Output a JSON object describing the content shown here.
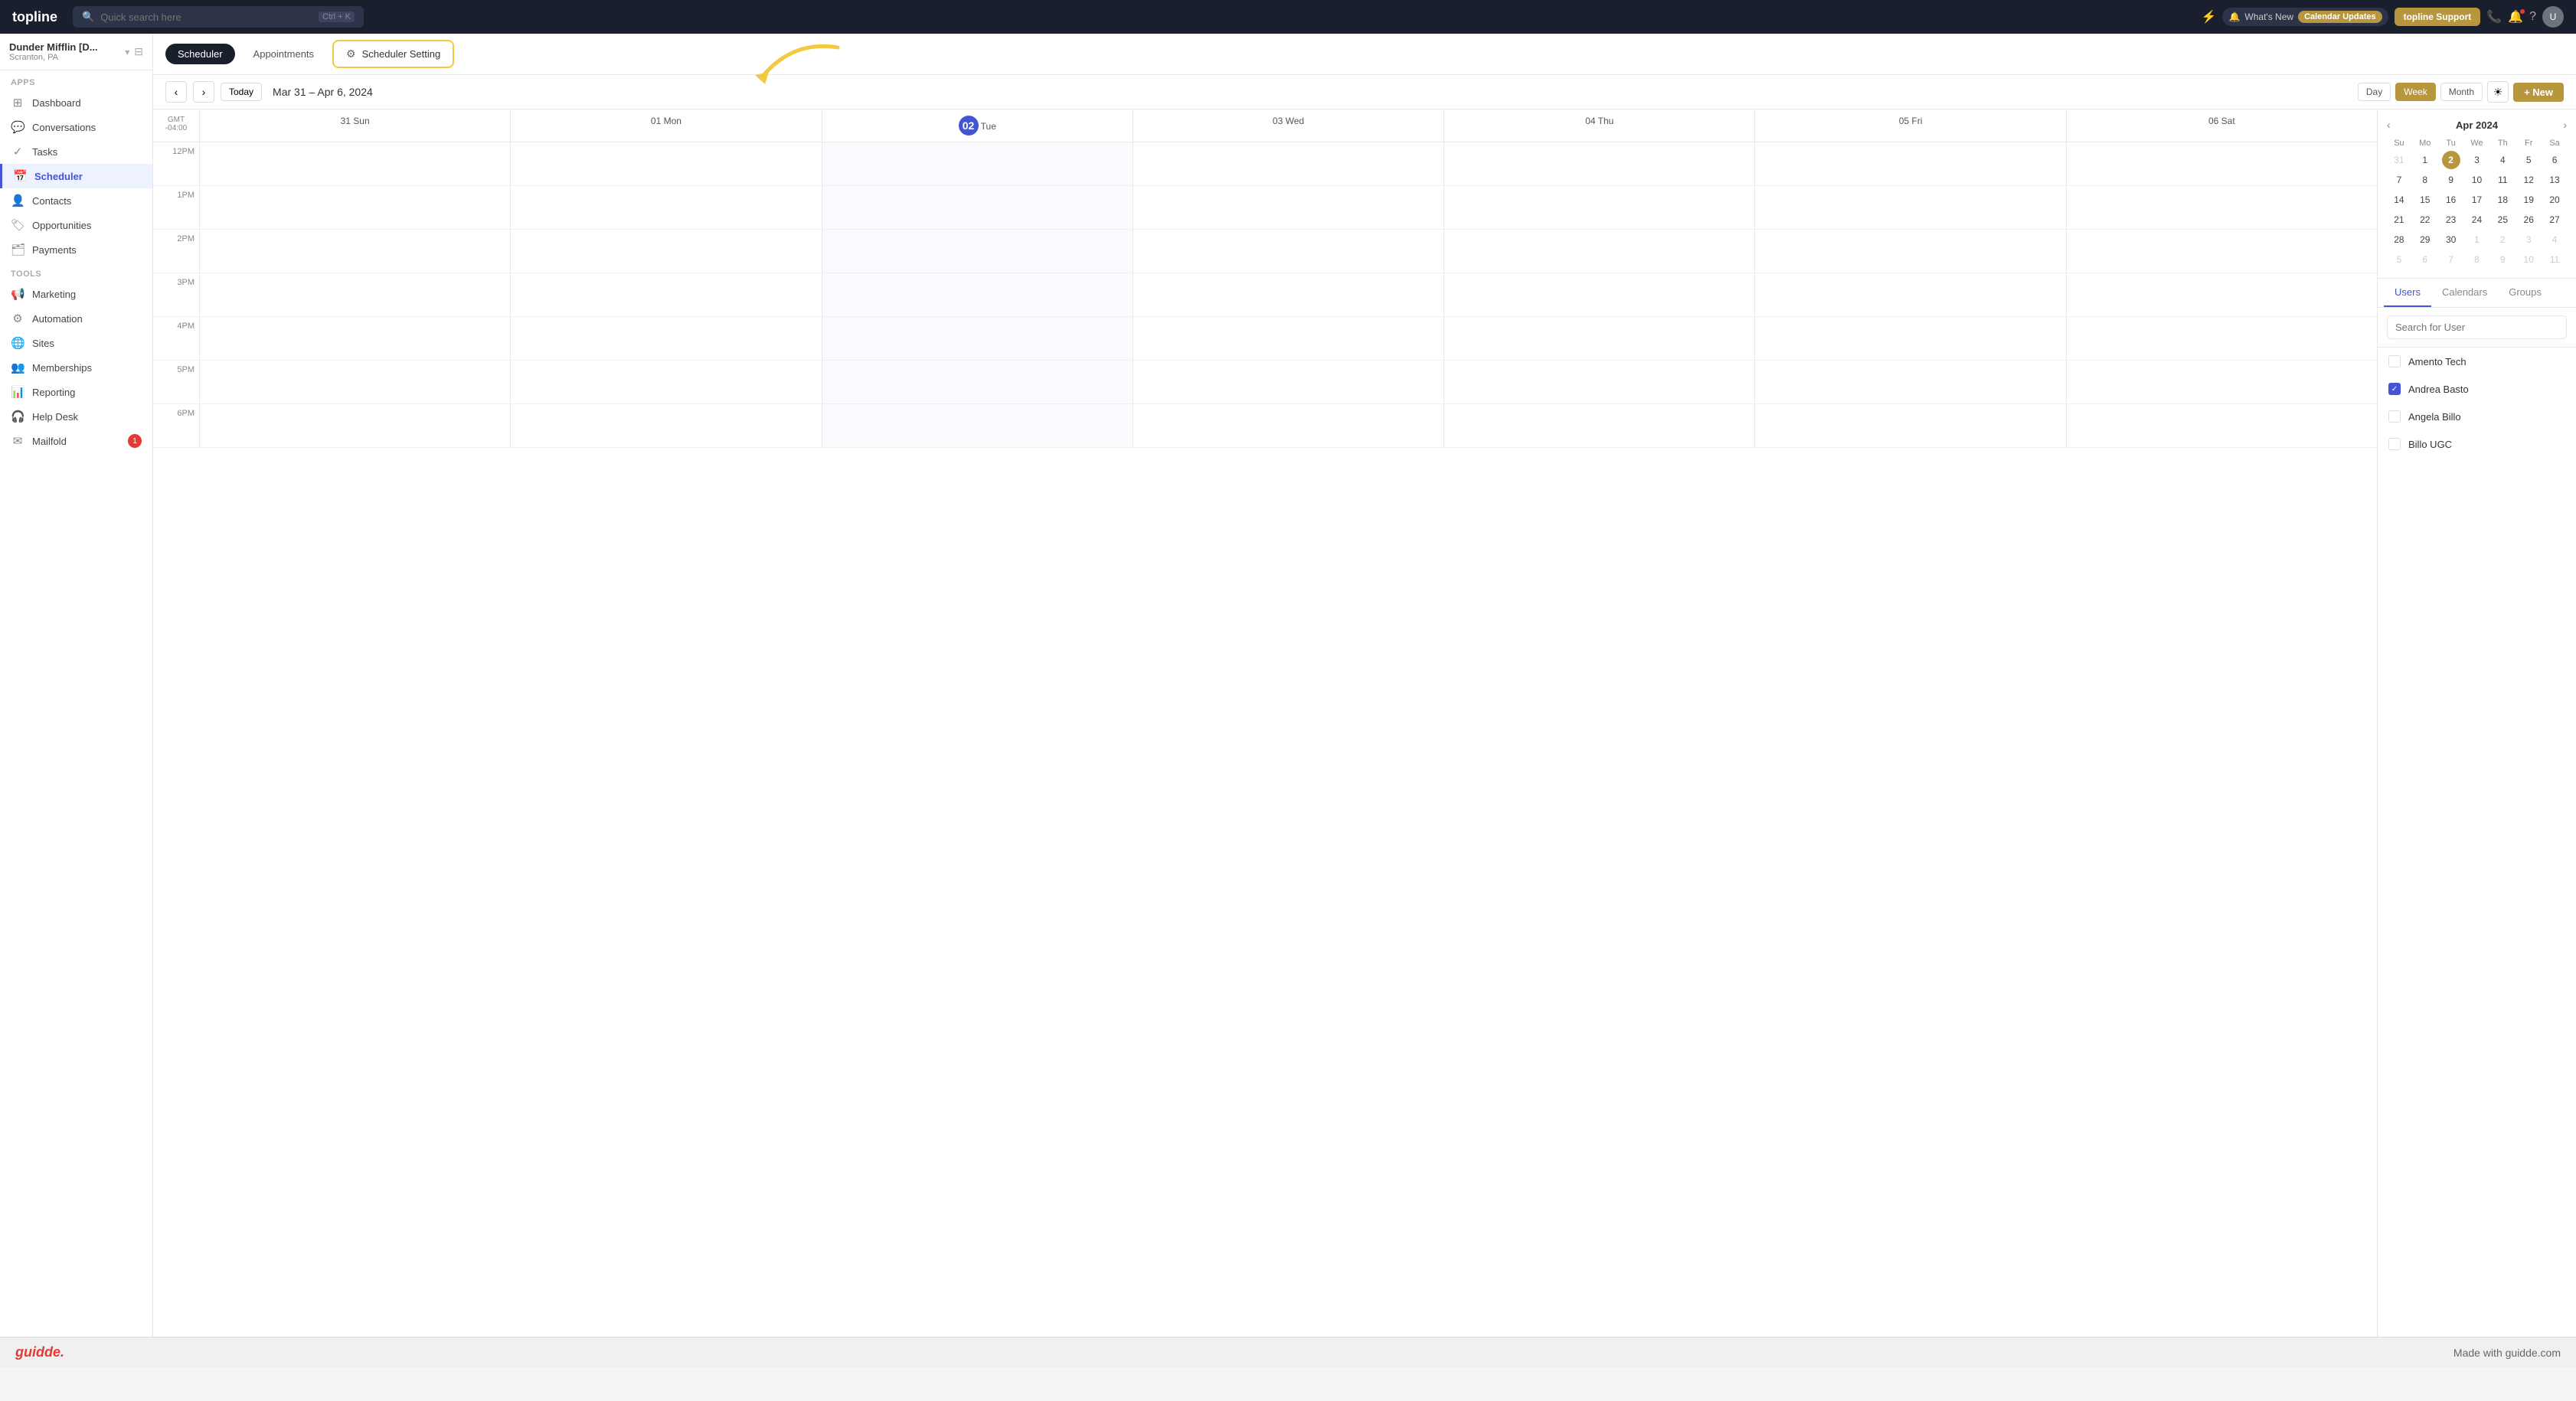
{
  "app": {
    "name": "topline"
  },
  "topbar": {
    "search_placeholder": "Quick search here",
    "shortcut": "Ctrl + K",
    "whats_new": "What's New",
    "calendar_updates": "Calendar Updates",
    "support_btn": "topline Support"
  },
  "sidebar": {
    "workspace_name": "Dunder Mifflin [D...",
    "workspace_location": "Scranton, PA",
    "apps_section": "Apps",
    "tools_section": "Tools",
    "items": [
      {
        "id": "dashboard",
        "label": "Dashboard",
        "icon": "⊞"
      },
      {
        "id": "conversations",
        "label": "Conversations",
        "icon": "💬"
      },
      {
        "id": "tasks",
        "label": "Tasks",
        "icon": "✓"
      },
      {
        "id": "scheduler",
        "label": "Scheduler",
        "icon": "📅",
        "active": true
      },
      {
        "id": "contacts",
        "label": "Contacts",
        "icon": "👤"
      },
      {
        "id": "opportunities",
        "label": "Opportunities",
        "icon": "🏷"
      },
      {
        "id": "payments",
        "label": "Payments",
        "icon": "🗂"
      }
    ],
    "tools": [
      {
        "id": "marketing",
        "label": "Marketing",
        "icon": "📢"
      },
      {
        "id": "automation",
        "label": "Automation",
        "icon": "⚙"
      },
      {
        "id": "sites",
        "label": "Sites",
        "icon": "🌐"
      },
      {
        "id": "memberships",
        "label": "Memberships",
        "icon": "👥"
      },
      {
        "id": "reporting",
        "label": "Reporting",
        "icon": "📊"
      },
      {
        "id": "helpdesk",
        "label": "Help Desk",
        "icon": "🎧"
      },
      {
        "id": "mailfold",
        "label": "Mailfold",
        "icon": "✉",
        "badge": "1"
      }
    ]
  },
  "sub_header": {
    "tabs": [
      {
        "id": "scheduler",
        "label": "Scheduler",
        "active": true
      },
      {
        "id": "appointments",
        "label": "Appointments",
        "active": false
      }
    ],
    "settings_tab": "Scheduler Setting"
  },
  "cal_toolbar": {
    "today_label": "Today",
    "date_range": "Mar 31 – Apr 6, 2024",
    "day_label": "Day",
    "week_label": "Week",
    "month_label": "Month",
    "new_label": "+ New"
  },
  "calendar": {
    "gmt_label": "GMT",
    "gmt_offset": "-04:00",
    "days": [
      {
        "short": "Sun",
        "num": "31",
        "today": false
      },
      {
        "short": "Mon",
        "num": "01",
        "today": false
      },
      {
        "short": "Tue",
        "num": "02",
        "today": true
      },
      {
        "short": "Wed",
        "num": "03",
        "today": false
      },
      {
        "short": "Thu",
        "num": "04",
        "today": false
      },
      {
        "short": "Fri",
        "num": "05",
        "today": false
      },
      {
        "short": "Sat",
        "num": "06",
        "today": false
      }
    ],
    "time_slots": [
      "12PM",
      "1PM",
      "2PM",
      "3PM",
      "4PM",
      "5PM",
      "6PM"
    ]
  },
  "mini_cal": {
    "title": "Apr 2024",
    "day_names": [
      "Su",
      "Mo",
      "Tu",
      "We",
      "Th",
      "Fr",
      "Sa"
    ],
    "weeks": [
      [
        {
          "num": "31",
          "other": true
        },
        {
          "num": "1",
          "other": false
        },
        {
          "num": "2",
          "today": true
        },
        {
          "num": "3",
          "other": false
        },
        {
          "num": "4",
          "other": false
        },
        {
          "num": "5",
          "other": false
        },
        {
          "num": "6",
          "other": false
        }
      ],
      [
        {
          "num": "7"
        },
        {
          "num": "8"
        },
        {
          "num": "9"
        },
        {
          "num": "10"
        },
        {
          "num": "11"
        },
        {
          "num": "12"
        },
        {
          "num": "13"
        }
      ],
      [
        {
          "num": "14"
        },
        {
          "num": "15"
        },
        {
          "num": "16"
        },
        {
          "num": "17"
        },
        {
          "num": "18"
        },
        {
          "num": "19"
        },
        {
          "num": "20"
        }
      ],
      [
        {
          "num": "21"
        },
        {
          "num": "22"
        },
        {
          "num": "23"
        },
        {
          "num": "24"
        },
        {
          "num": "25"
        },
        {
          "num": "26"
        },
        {
          "num": "27"
        }
      ],
      [
        {
          "num": "28"
        },
        {
          "num": "29"
        },
        {
          "num": "30"
        },
        {
          "num": "1",
          "other": true
        },
        {
          "num": "2",
          "other": true
        },
        {
          "num": "3",
          "other": true
        },
        {
          "num": "4",
          "other": true
        }
      ],
      [
        {
          "num": "5",
          "other": true
        },
        {
          "num": "6",
          "other": true
        },
        {
          "num": "7",
          "other": true
        },
        {
          "num": "8",
          "other": true
        },
        {
          "num": "9",
          "other": true
        },
        {
          "num": "10",
          "other": true
        },
        {
          "num": "11",
          "other": true
        }
      ]
    ]
  },
  "right_panel": {
    "tabs": [
      {
        "id": "users",
        "label": "Users",
        "active": true
      },
      {
        "id": "calendars",
        "label": "Calendars",
        "active": false
      },
      {
        "id": "groups",
        "label": "Groups",
        "active": false
      }
    ],
    "search_placeholder": "Search for User",
    "users": [
      {
        "name": "Amento Tech",
        "checked": false
      },
      {
        "name": "Andrea Basto",
        "checked": true
      },
      {
        "name": "Angela Billo",
        "checked": false
      },
      {
        "name": "Billo UGC",
        "checked": false
      }
    ]
  },
  "bottom_bar": {
    "logo": "guidde.",
    "made_with": "Made with guidde.com"
  }
}
